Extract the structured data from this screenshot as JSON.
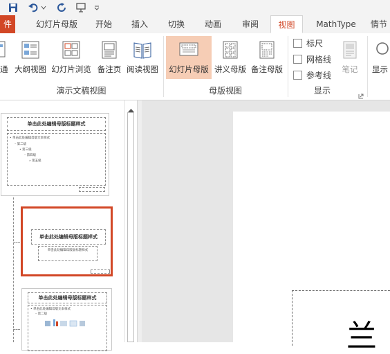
{
  "tabs": {
    "file": "件",
    "slide_master": "幻灯片母版",
    "start": "开始",
    "insert": "插入",
    "transitions": "切换",
    "animations": "动画",
    "review": "审阅",
    "view": "视图",
    "mathtype": "MathType",
    "partial": "情节"
  },
  "ribbon": {
    "btn_partial_left": "通",
    "btn_outline": "大纲视图",
    "btn_slide_sorter": "幻灯片浏览",
    "btn_notes_page": "备注页",
    "btn_reading": "阅读视图",
    "group_presentation_views": "演示文稿视图",
    "btn_slide_master": "幻灯片母版",
    "btn_handout_master": "讲义母版",
    "btn_notes_master": "备注母版",
    "group_master_views": "母版视图",
    "chk_ruler": "标尺",
    "chk_gridlines": "网格线",
    "chk_guides": "参考线",
    "btn_notes": "笔记",
    "group_show": "显示",
    "btn_partial_right": "显示"
  },
  "thumbnails": {
    "master_title": "单击此处编辑母版标题样式",
    "master_body_1": "• 单击此处编辑母版文本样式",
    "master_body_2": "– 第二级",
    "master_body_3": "• 第三级",
    "master_body_4": "– 第四级",
    "master_body_5": "» 第五级",
    "layout1_title": "单击此处编辑母版标题样式",
    "layout1_sub": "单击此处编辑母版副标题样式",
    "layout2_title": "单击此处编辑母版标题样式",
    "layout2_body": "• 单击此处编辑母版文本样式",
    "layout2_body2": "– 第二级"
  },
  "canvas": {
    "partial_char": "兰"
  },
  "colors": {
    "accent": "#d24726",
    "selected_button": "#f6cdb5"
  }
}
